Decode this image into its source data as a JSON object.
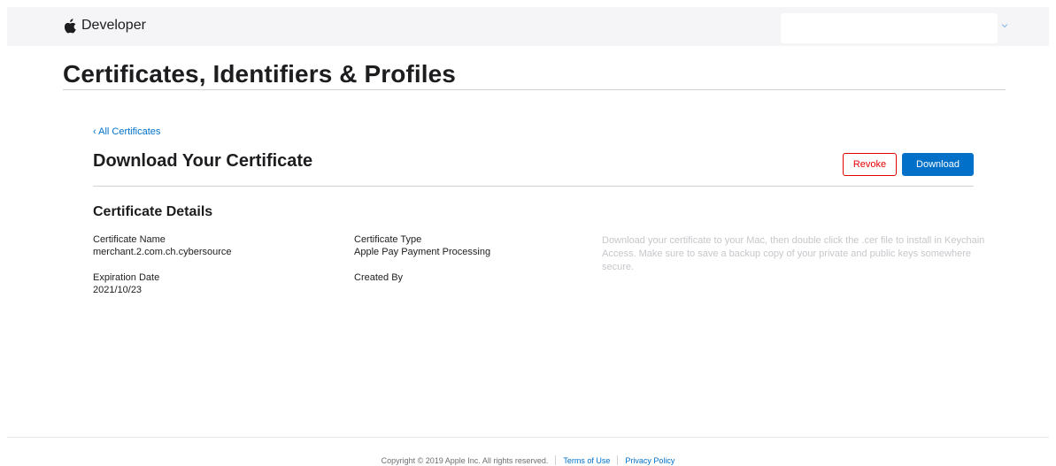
{
  "header": {
    "brand_label": "Developer",
    "logo_icon": "apple-logo-icon",
    "account_chevron_icon": "chevron-down-icon"
  },
  "page": {
    "title": "Certificates, Identifiers & Profiles"
  },
  "breadcrumb": {
    "back_label": "‹ All Certificates"
  },
  "certificate": {
    "section_title": "Download Your Certificate",
    "revoke_label": "Revoke",
    "download_label": "Download",
    "details_heading": "Certificate Details",
    "name_label": "Certificate Name",
    "name_value": "merchant.2.com.ch.cybersource",
    "expiry_label": "Expiration Date",
    "expiry_value": "2021/10/23",
    "type_label": "Certificate Type",
    "type_value": "Apple Pay Payment Processing",
    "created_by_label": "Created By",
    "created_by_value": "",
    "help_text": "Download your certificate to your Mac, then double click the .cer file to install in Keychain Access. Make sure to save a backup copy of your private and public keys somewhere secure."
  },
  "footer": {
    "copyright": "Copyright © 2019 Apple Inc. All rights reserved.",
    "terms_label": "Terms of Use",
    "privacy_label": "Privacy Policy"
  },
  "colors": {
    "accent": "#0070c9",
    "danger": "#e30000",
    "topbar_bg": "#f5f5f7"
  }
}
